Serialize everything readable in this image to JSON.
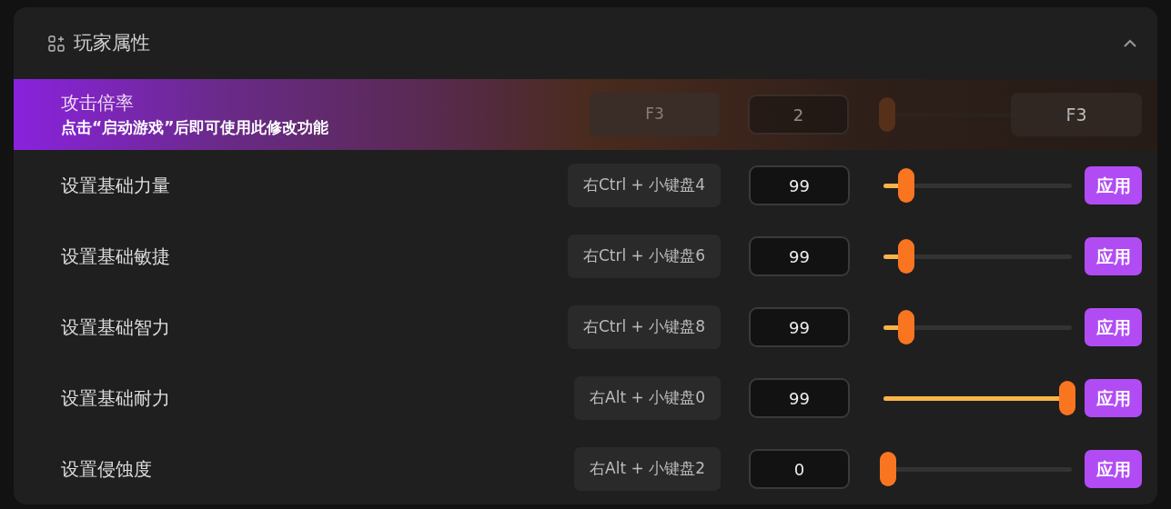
{
  "panel": {
    "title": "玩家属性",
    "expanded": true
  },
  "rows": [
    {
      "label": "攻击倍率",
      "notice": "点击“启动游戏”后即可使用此修改功能",
      "disabled": true,
      "hotkey": "F3",
      "value": "2",
      "level": 0,
      "button": "F3"
    },
    {
      "label": "设置基础力量",
      "disabled": false,
      "hotkey": "右Ctrl + 小键盘4",
      "value": "99",
      "level": 0.1,
      "button": "应用"
    },
    {
      "label": "设置基础敏捷",
      "disabled": false,
      "hotkey": "右Ctrl + 小键盘6",
      "value": "99",
      "level": 0.1,
      "button": "应用"
    },
    {
      "label": "设置基础智力",
      "disabled": false,
      "hotkey": "右Ctrl + 小键盘8",
      "value": "99",
      "level": 0.1,
      "button": "应用"
    },
    {
      "label": "设置基础耐力",
      "disabled": false,
      "hotkey": "右Alt + 小键盘0",
      "value": "99",
      "level": 1,
      "button": "应用"
    },
    {
      "label": "设置侵蚀度",
      "disabled": false,
      "hotkey": "右Alt + 小键盘2",
      "value": "0",
      "level": 0,
      "button": "应用"
    }
  ]
}
